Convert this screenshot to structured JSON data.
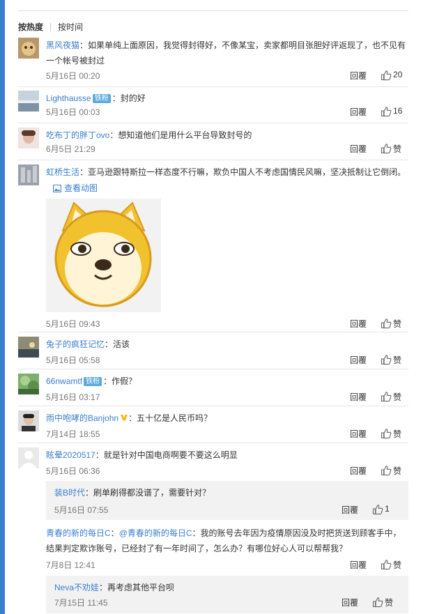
{
  "sort": {
    "hot": "按热度",
    "time": "按时间"
  },
  "reply_label": "回覆",
  "like_label": "赞",
  "comments": [
    {
      "user": "黑风夜猫",
      "text": "：如果单纯上面原因，我觉得封得好，不像某宝，卖家都明目张胆好评返现了，也不见有一个帐号被封过",
      "time": "5月16日 00:20",
      "likes": "20"
    },
    {
      "user": "Lighthausse",
      "badge": "铁粉",
      "text": "：封的好",
      "time": "5月16日 00:03",
      "likes": "16"
    },
    {
      "user": "吃布丁的胖丁ovo",
      "text": "：想知道他们是用什么平台导致封号的",
      "time": "6月5日 21:29",
      "likes": "赞"
    },
    {
      "user": "虹桥生活",
      "text": "：亚马逊跟特斯拉一样态度不行嘛，欺负中国人不考虑国情民风嘛，坚决抵制让它倒闭。",
      "gif_link": "查看动图",
      "time": "5月16日 09:43",
      "likes": "赞"
    },
    {
      "user": "兔子的疯狂记忆",
      "text": "：活该",
      "time": "5月16日 05:58",
      "likes": "赞"
    },
    {
      "user": "66nwamtf",
      "badge": "铁粉",
      "text": "：作假？",
      "time": "5月16日 03:17",
      "likes": "赞"
    },
    {
      "user": "雨中咆哮的Banjohn",
      "text": "：五十亿是人民币吗？",
      "time": "7月14日 18:55",
      "likes": "赞"
    },
    {
      "user": "眩晕2020517",
      "text": "：就是针对中国电商啊要不要这么明显",
      "time": "5月16日 06:36",
      "likes": "赞"
    }
  ],
  "sub_reply_1": {
    "user": "装B时代",
    "text": "：刷单刷得都没谱了，需要针对？",
    "time": "5月16日 07:55",
    "likes": "1"
  },
  "thread_reply": {
    "user": "青春的新的每日C",
    "mention": "@青春的新的每日C",
    "text": "：我的账号去年因为疫情原因没及时把货送到顾客手中，结果判定欺诈账号，已经封了有一年时间了，怎么办？有哪位好心人可以帮帮我？",
    "time": "7月8日 12:41",
    "likes": "赞"
  },
  "sub_reply_2": {
    "user": "Neva不劝娃",
    "text": "：再考虑其他平台呗",
    "time": "7月15日 11:45",
    "likes": "赞"
  },
  "colors": {
    "link": "#3c7ecf",
    "accent_bar": "#3c7ecf",
    "badge": "#5ea9df"
  }
}
